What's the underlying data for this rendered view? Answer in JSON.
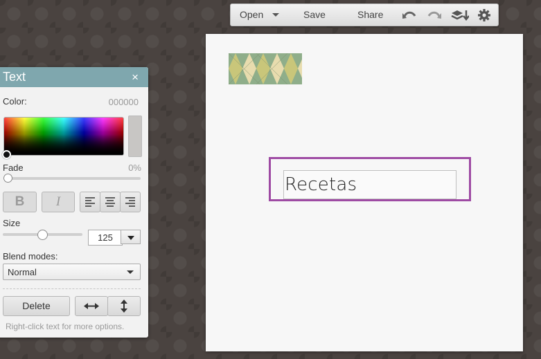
{
  "toolbar": {
    "open_label": "Open",
    "save_label": "Save",
    "share_label": "Share",
    "icons": [
      "chevron-down-icon",
      "undo-icon",
      "redo-icon",
      "layers-icon",
      "gear-icon"
    ]
  },
  "canvas": {
    "text_content": "Recetas",
    "selection_color": "#9e4aa3",
    "pattern_colors": [
      "#8fae8a",
      "#c9c67a",
      "#e8dcae"
    ]
  },
  "text_panel": {
    "title": "Text",
    "close_label": "×",
    "color_label": "Color:",
    "color_value": "000000",
    "fade_label": "Fade",
    "fade_value": "0%",
    "bold_label": "B",
    "italic_label": "I",
    "size_label": "Size",
    "size_value": "125",
    "blend_label": "Blend modes:",
    "blend_value": "Normal",
    "delete_label": "Delete",
    "hint": "Right-click text for more options.",
    "header_color": "#7fa7ae"
  }
}
